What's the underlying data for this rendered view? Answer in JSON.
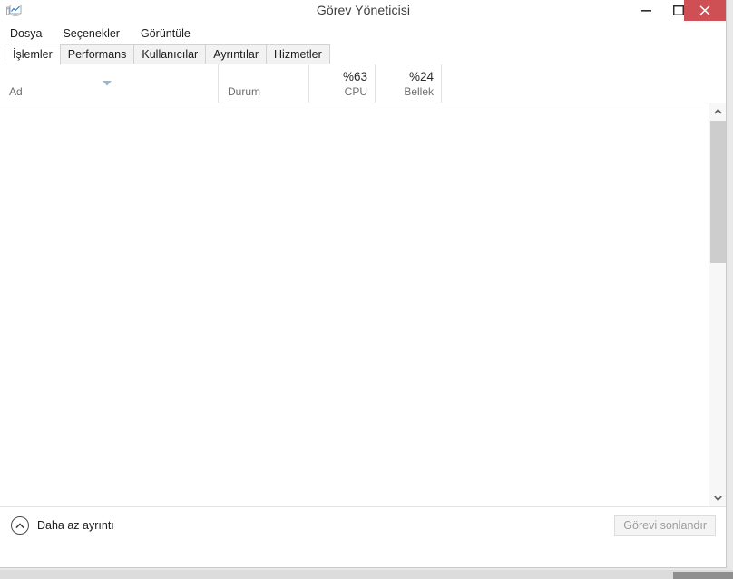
{
  "window": {
    "title": "Görev Yöneticisi",
    "icon": "task-manager-icon",
    "controls": {
      "minimize": "minimize-icon",
      "maximize": "maximize-icon",
      "close": "close-icon",
      "close_color": "#cf5054"
    }
  },
  "menu": {
    "items": [
      {
        "label": "Dosya"
      },
      {
        "label": "Seçenekler"
      },
      {
        "label": "Görüntüle"
      }
    ]
  },
  "tabs": [
    {
      "label": "İşlemler",
      "active": true
    },
    {
      "label": "Performans",
      "active": false
    },
    {
      "label": "Kullanıcılar",
      "active": false
    },
    {
      "label": "Ayrıntılar",
      "active": false
    },
    {
      "label": "Hizmetler",
      "active": false
    }
  ],
  "columns": [
    {
      "id": "name",
      "label": "Ad",
      "pct": "",
      "align": "left",
      "sorted": true
    },
    {
      "id": "status",
      "label": "Durum",
      "pct": "",
      "align": "left",
      "sorted": false
    },
    {
      "id": "cpu",
      "label": "CPU",
      "pct": "%63",
      "align": "right",
      "sorted": false
    },
    {
      "id": "memory",
      "label": "Bellek",
      "pct": "%24",
      "align": "right",
      "sorted": false
    }
  ],
  "rows": [],
  "scrollbar": {
    "up_icon": "chevron-up-icon",
    "down_icon": "chevron-down-icon",
    "thumb_top_pct": 4,
    "thumb_height_pct": 35
  },
  "statusbar": {
    "fewer_details_label": "Daha az ayrıntı",
    "fewer_details_icon": "chevron-up-circle-icon",
    "end_task_label": "Görevi sonlandır",
    "end_task_enabled": false
  }
}
